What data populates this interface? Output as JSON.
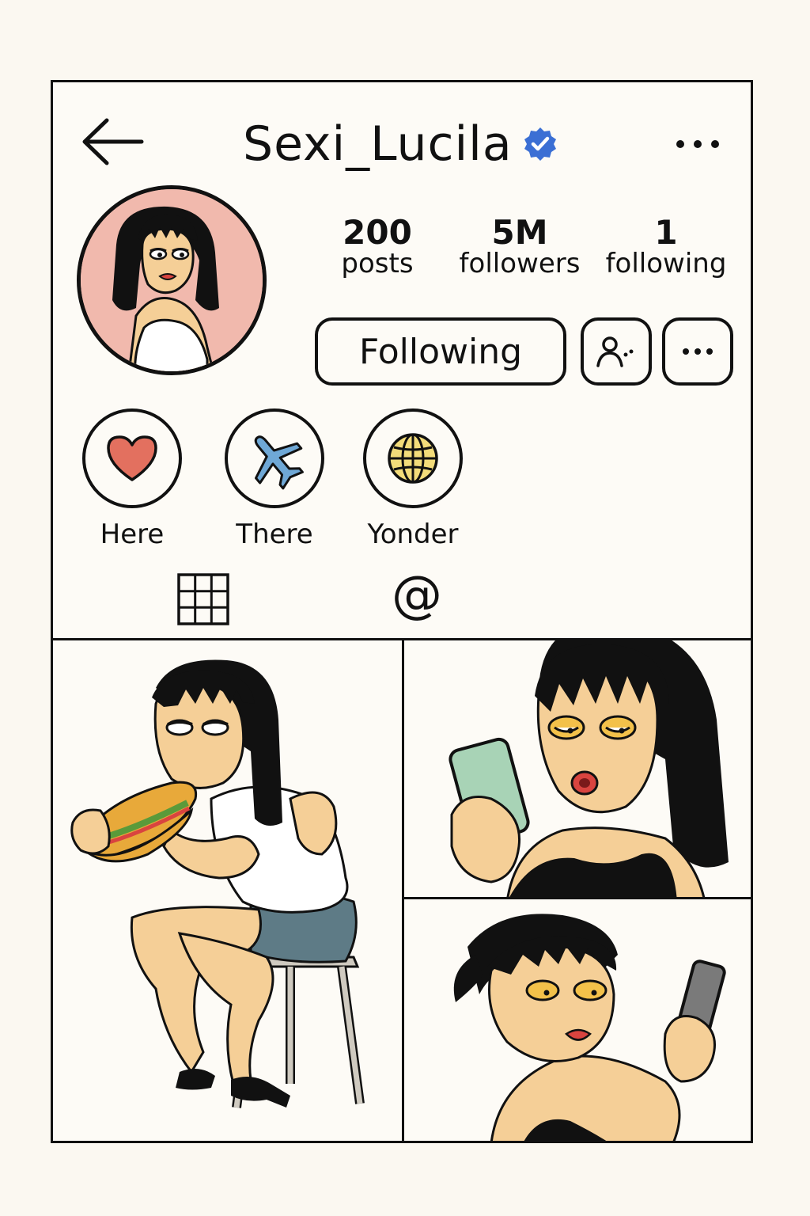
{
  "header": {
    "back_icon": "arrow-left-icon",
    "username": "Sexi_Lucila",
    "verified_icon": "verified-badge-icon",
    "more_icon": "more-horizontal-icon"
  },
  "profile": {
    "avatar": "avatar",
    "stats": [
      {
        "value": "200",
        "label": "posts"
      },
      {
        "value": "5M",
        "label": "followers"
      },
      {
        "value": "1",
        "label": "following"
      }
    ]
  },
  "actions": {
    "following_label": "Following",
    "suggest_icon": "person-suggest-icon",
    "more_icon": "more-horizontal-icon"
  },
  "highlights": [
    {
      "label": "Here",
      "icon": "heart-icon",
      "color": "#e3705f"
    },
    {
      "label": "There",
      "icon": "airplane-icon",
      "color": "#6fa8d6"
    },
    {
      "label": "Yonder",
      "icon": "globe-icon",
      "color": "#f3dc7a"
    }
  ],
  "tabs": {
    "grid_icon": "grid-icon",
    "mentions_label": "@"
  },
  "colors": {
    "verified": "#3b6fd4",
    "avatar_bg": "#f1b9ad",
    "skin": "#f5cf97",
    "hair": "#111111"
  }
}
